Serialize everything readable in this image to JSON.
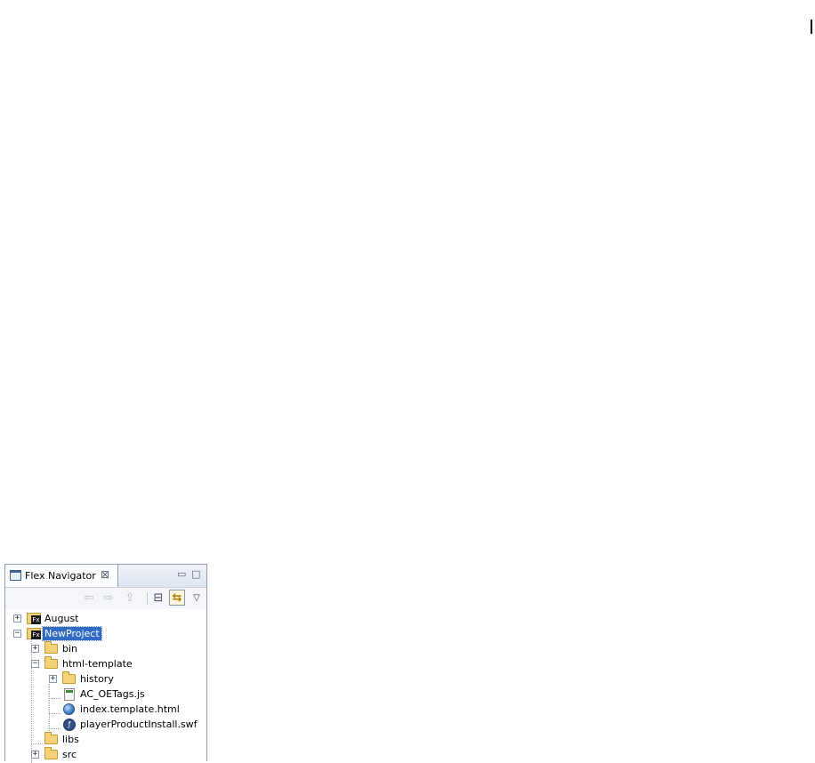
{
  "view": {
    "title": "Flex Navigator",
    "close_glyph": "⊠",
    "minimize_glyph": "▭",
    "maximize_glyph": "□",
    "menu_glyph": "▽"
  },
  "toolbar": {
    "back_glyph": "⇦",
    "forward_glyph": "⇨",
    "up_glyph": "⇪",
    "collapse_glyph": "⊟",
    "link_glyph": "⇆"
  },
  "tree": {
    "items": [
      {
        "label": "August",
        "icon": "flex-project-icon",
        "toggle": "+"
      },
      {
        "label": "NewProject",
        "icon": "flex-project-icon",
        "toggle": "−",
        "selected": true
      },
      {
        "label": "bin",
        "icon": "folder-icon",
        "toggle": "+"
      },
      {
        "label": "html-template",
        "icon": "folder-icon",
        "toggle": "−"
      },
      {
        "label": "history",
        "icon": "folder-icon",
        "toggle": "+"
      },
      {
        "label": "AC_OETags.js",
        "icon": "js-file-icon"
      },
      {
        "label": "index.template.html",
        "icon": "html-file-icon"
      },
      {
        "label": "playerProductInstall.swf",
        "icon": "swf-file-icon"
      },
      {
        "label": "libs",
        "icon": "folder-icon"
      },
      {
        "label": "src",
        "icon": "folder-icon",
        "toggle": "+"
      }
    ]
  },
  "colors": {
    "selection": "#316ac5",
    "view_border": "#8f9db2"
  }
}
